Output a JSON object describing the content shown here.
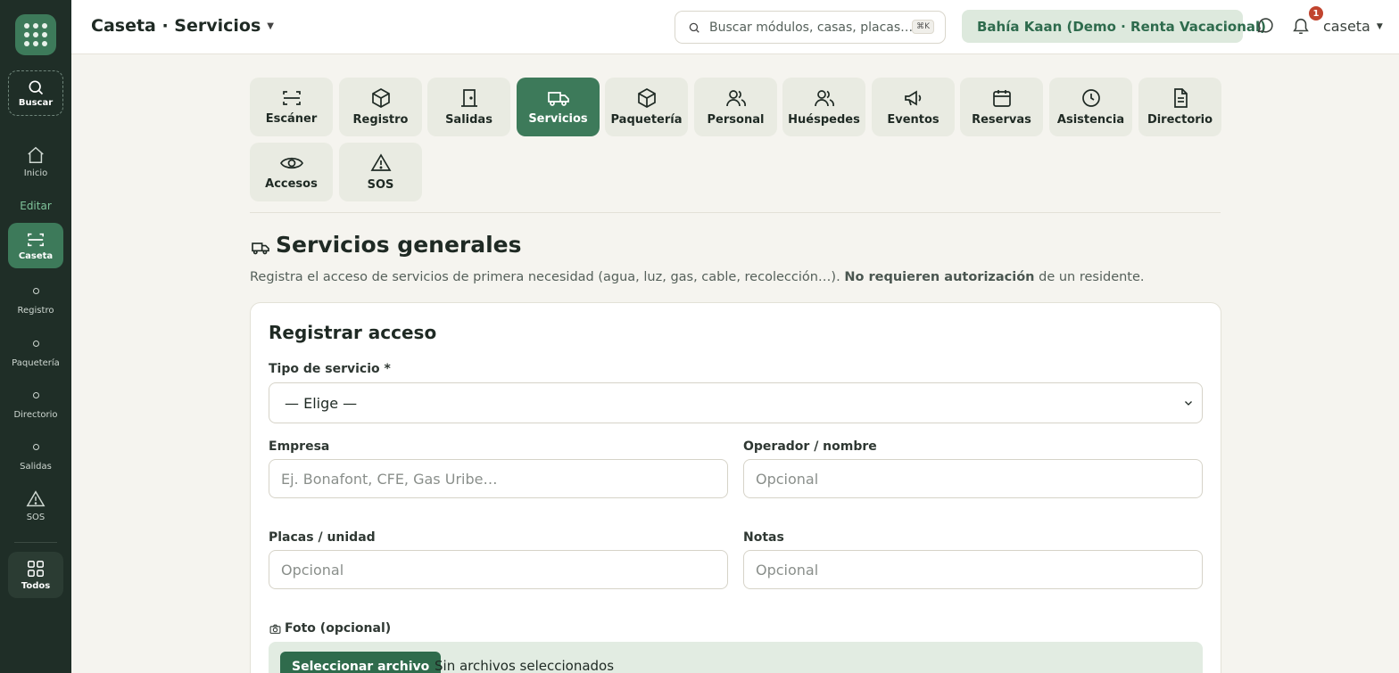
{
  "sidebar": {
    "search_label": "Buscar",
    "section_label": "Editar",
    "items": [
      {
        "label": "Inicio",
        "icon": "home-icon"
      },
      {
        "label": "Caseta",
        "icon": "scan-icon",
        "active": true
      },
      {
        "label": "Registro",
        "icon": "dot-icon"
      },
      {
        "label": "Paquetería",
        "icon": "dot-icon"
      },
      {
        "label": "Directorio",
        "icon": "dot-icon"
      },
      {
        "label": "Salidas",
        "icon": "dot-icon"
      },
      {
        "label": "SOS",
        "icon": "alert-triangle-icon"
      }
    ],
    "all_label": "Todos"
  },
  "header": {
    "title": "Caseta · Servicios",
    "search_placeholder": "Buscar módulos, casas, placas…",
    "search_shortcut": "⌘K",
    "org_name": "Bahía Kaan (Demo · Renta Vacacional)",
    "notification_count": "1",
    "user_name": "caseta"
  },
  "tabs": [
    {
      "label": "Escáner",
      "icon": "scan-icon"
    },
    {
      "label": "Registro",
      "icon": "box-icon"
    },
    {
      "label": "Salidas",
      "icon": "door-icon"
    },
    {
      "label": "Servicios",
      "icon": "truck-icon",
      "active": true
    },
    {
      "label": "Paquetería",
      "icon": "box-icon"
    },
    {
      "label": "Personal",
      "icon": "users-icon"
    },
    {
      "label": "Huéspedes",
      "icon": "users-icon"
    },
    {
      "label": "Eventos",
      "icon": "megaphone-icon"
    },
    {
      "label": "Reservas",
      "icon": "calendar-icon"
    },
    {
      "label": "Asistencia",
      "icon": "clock-icon"
    },
    {
      "label": "Directorio",
      "icon": "document-icon"
    },
    {
      "label": "Accesos",
      "icon": "eye-icon"
    },
    {
      "label": "SOS",
      "icon": "alert-triangle-icon"
    }
  ],
  "section": {
    "title": "Servicios generales",
    "desc_before": "Registra el acceso de servicios de primera necesidad (agua, luz, gas, cable, recolección…). ",
    "desc_bold": "No requieren autorización",
    "desc_after": " de un residente."
  },
  "form": {
    "title": "Registrar acceso",
    "service_type_label": "Tipo de servicio *",
    "service_type_value": "— Elige —",
    "company_label": "Empresa",
    "company_placeholder": "Ej. Bonafont, CFE, Gas Uribe…",
    "operator_label": "Operador / nombre",
    "operator_placeholder": "Opcional",
    "plates_label": "Placas / unidad",
    "plates_placeholder": "Opcional",
    "notes_label": "Notas",
    "notes_placeholder": "Opcional",
    "photo_label": "Foto (opcional)",
    "file_button": "Seleccionar archivo",
    "file_status": "Sin archivos seleccionados"
  },
  "colors": {
    "sidebar_bg": "#1f2e27",
    "accent": "#3d7a5a",
    "page_bg": "#f5f4ef",
    "badge": "#c1442e"
  }
}
